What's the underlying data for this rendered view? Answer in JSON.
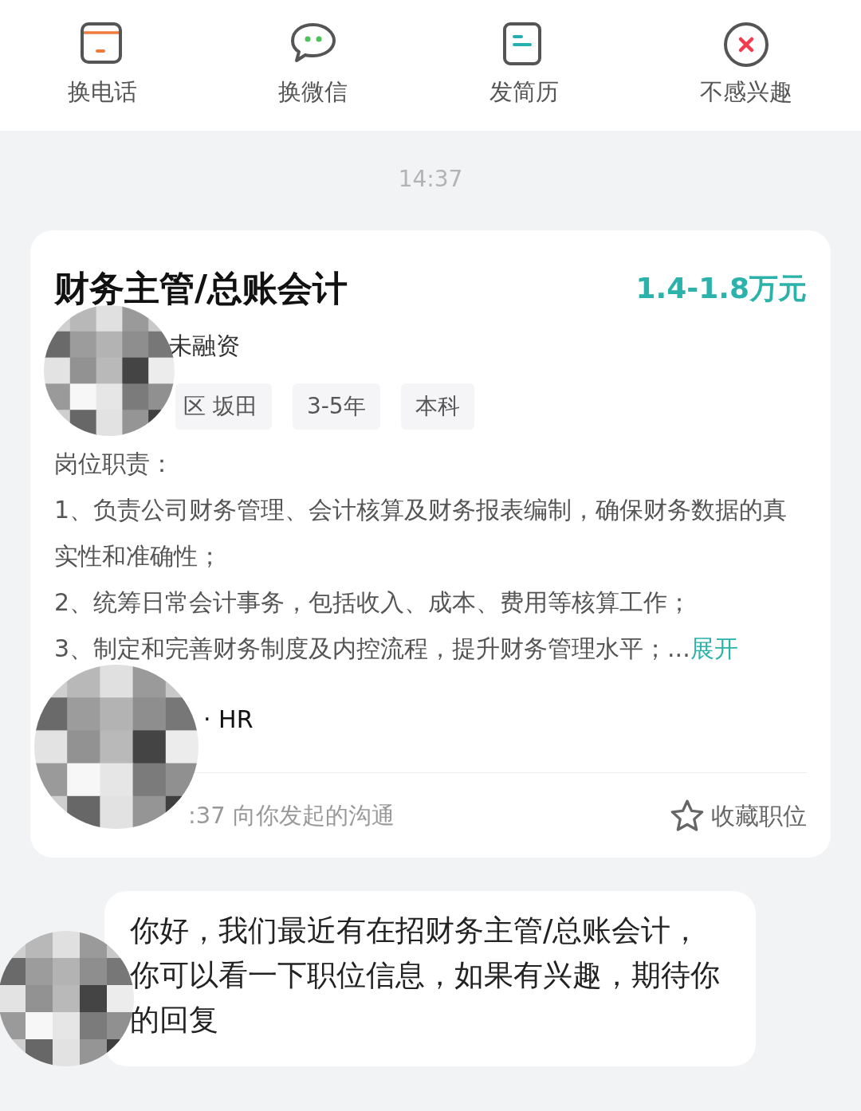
{
  "actions": [
    {
      "kind": "phone",
      "label": "换电话"
    },
    {
      "kind": "wechat",
      "label": "换微信"
    },
    {
      "kind": "resume",
      "label": "发简历"
    },
    {
      "kind": "decline",
      "label": "不感兴趣"
    }
  ],
  "timestamp": "14:37",
  "job_card": {
    "title": "财务主管/总账会计",
    "salary": "1.4-1.8万元",
    "company_info": "未融资",
    "tags": [
      "区 坂田",
      "3-5年",
      "本科"
    ],
    "description": {
      "heading": "岗位职责：",
      "lines": [
        "1、负责公司财务管理、会计核算及财务报表编制，确保财务数据的真实性和准确性；",
        "2、统筹日常会计事务，包括收入、成本、费用等核算工作；",
        "3、制定和完善财务制度及内控流程，提升财务管理水平；..."
      ],
      "expand_label": "展开"
    },
    "recruiter": "· HR",
    "initiated_note": ":37 向你发起的沟通",
    "favorite_label": "收藏职位",
    "favorited": false
  },
  "message": {
    "lines": [
      "你好，我们最近有在招财务主管/总账会计，",
      "你可以看一下职位信息，如果有兴趣，期待你的回复"
    ]
  }
}
